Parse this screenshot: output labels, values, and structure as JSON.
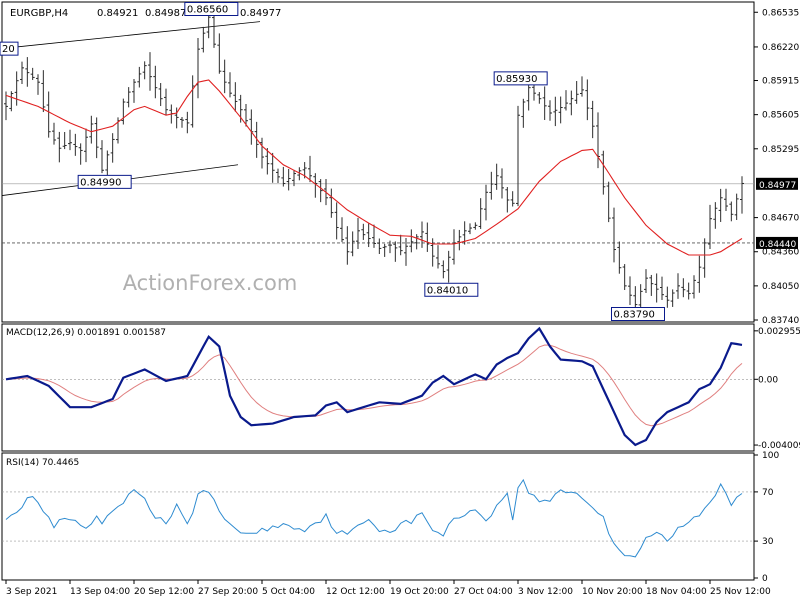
{
  "header": {
    "symbol_label": "EURGBP,H4",
    "ohlc_values": [
      "0.84921",
      "0.84987",
      "0.84906",
      "0.84977"
    ]
  },
  "watermark": "ActionForex.com",
  "colors": {
    "background": "#ffffff",
    "bar": "#2a2a2a",
    "ma": "#e02020",
    "macd_line": "#0a1a8c",
    "macd_signal": "#e08080",
    "rsi": "#2e8bd0",
    "level_line": "#555555",
    "frame": "#000000",
    "tag_border": "#0a1a8c",
    "current_price_tag": "#000000"
  },
  "price_panel": {
    "ylim": [
      0.8374,
      0.8661
    ],
    "y_ticks": [
      "0.86535",
      "0.86220",
      "0.85915",
      "0.85605",
      "0.85295",
      "0.84670",
      "0.84360",
      "0.84050",
      "0.83740"
    ],
    "current_price": "0.84977",
    "level_price": "0.84440",
    "annotations": [
      {
        "label": "0.86560",
        "x": 38.5,
        "y": 0.8656
      },
      {
        "label": "0.84990",
        "x": 18.5,
        "y": 0.8499
      },
      {
        "label": "0.85930",
        "x": 96.5,
        "y": 0.8593
      },
      {
        "label": "0.84010",
        "x": 83.5,
        "y": 0.8401
      },
      {
        "label": "0.83790",
        "x": 118.5,
        "y": 0.8379
      },
      {
        "label": "20",
        "x": -1,
        "y": 0.862
      }
    ]
  },
  "macd_panel": {
    "label": "MACD(12,26,9) 0.001891 0.001587",
    "ylim": [
      -0.00425,
      0.00325
    ],
    "y_ticks": [
      "0.002955",
      "0.00",
      "-0.004009"
    ]
  },
  "rsi_panel": {
    "label": "RSI(14) 70.4465",
    "ylim": [
      0,
      100
    ],
    "y_ticks": [
      "100",
      "70",
      "30",
      "0"
    ],
    "levels": [
      70,
      30
    ]
  },
  "x_axis": {
    "ticks": [
      {
        "label": "3 Sep 2021",
        "bar": 0
      },
      {
        "label": "13 Sep 04:00",
        "bar": 12
      },
      {
        "label": "20 Sep 12:00",
        "bar": 24
      },
      {
        "label": "27 Sep 20:00",
        "bar": 36
      },
      {
        "label": "5 Oct 04:00",
        "bar": 48
      },
      {
        "label": "12 Oct 12:00",
        "bar": 60
      },
      {
        "label": "19 Oct 20:00",
        "bar": 72
      },
      {
        "label": "27 Oct 04:00",
        "bar": 84
      },
      {
        "label": "3 Nov 12:00",
        "bar": 96
      },
      {
        "label": "10 Nov 20:00",
        "bar": 108
      },
      {
        "label": "18 Nov 04:00",
        "bar": 120
      },
      {
        "label": "25 Nov 12:00",
        "bar": 132
      }
    ]
  },
  "chart_data": {
    "type": "line",
    "series": [
      {
        "type": "ohlc",
        "close_anchors": [
          [
            0,
            0.8568
          ],
          [
            3,
            0.8603
          ],
          [
            6,
            0.859
          ],
          [
            8,
            0.8545
          ],
          [
            10,
            0.853
          ],
          [
            12,
            0.8535
          ],
          [
            14,
            0.8528
          ],
          [
            16,
            0.8552
          ],
          [
            18,
            0.851
          ],
          [
            20,
            0.8538
          ],
          [
            22,
            0.8572
          ],
          [
            24,
            0.859
          ],
          [
            26,
            0.8605
          ],
          [
            28,
            0.8585
          ],
          [
            30,
            0.8565
          ],
          [
            32,
            0.8558
          ],
          [
            34,
            0.8553
          ],
          [
            36,
            0.862
          ],
          [
            38,
            0.8649
          ],
          [
            40,
            0.86
          ],
          [
            42,
            0.858
          ],
          [
            44,
            0.8565
          ],
          [
            46,
            0.8545
          ],
          [
            48,
            0.8522
          ],
          [
            50,
            0.851
          ],
          [
            52,
            0.8498
          ],
          [
            54,
            0.8507
          ],
          [
            56,
            0.8512
          ],
          [
            58,
            0.8498
          ],
          [
            60,
            0.8485
          ],
          [
            62,
            0.8458
          ],
          [
            64,
            0.8436
          ],
          [
            66,
            0.8455
          ],
          [
            68,
            0.8448
          ],
          [
            70,
            0.8439
          ],
          [
            72,
            0.8442
          ],
          [
            74,
            0.8437
          ],
          [
            76,
            0.8445
          ],
          [
            78,
            0.8454
          ],
          [
            80,
            0.8432
          ],
          [
            82,
            0.8418
          ],
          [
            84,
            0.8444
          ],
          [
            86,
            0.8455
          ],
          [
            88,
            0.846
          ],
          [
            90,
            0.849
          ],
          [
            92,
            0.8505
          ],
          [
            94,
            0.8483
          ],
          [
            95,
            0.848
          ],
          [
            96,
            0.856
          ],
          [
            97,
            0.8572
          ],
          [
            98,
            0.8585
          ],
          [
            100,
            0.8575
          ],
          [
            102,
            0.8562
          ],
          [
            104,
            0.8567
          ],
          [
            106,
            0.8575
          ],
          [
            108,
            0.8583
          ],
          [
            110,
            0.855
          ],
          [
            112,
            0.8495
          ],
          [
            114,
            0.8438
          ],
          [
            116,
            0.8405
          ],
          [
            118,
            0.8388
          ],
          [
            120,
            0.8412
          ],
          [
            122,
            0.8402
          ],
          [
            124,
            0.8392
          ],
          [
            126,
            0.8405
          ],
          [
            128,
            0.8398
          ],
          [
            130,
            0.8422
          ],
          [
            132,
            0.8466
          ],
          [
            134,
            0.8485
          ],
          [
            136,
            0.847
          ],
          [
            138,
            0.8498
          ]
        ]
      },
      {
        "type": "line",
        "ma_anchors": [
          [
            0,
            0.8578
          ],
          [
            6,
            0.8568
          ],
          [
            12,
            0.8553
          ],
          [
            16,
            0.8545
          ],
          [
            20,
            0.855
          ],
          [
            24,
            0.8565
          ],
          [
            26,
            0.8568
          ],
          [
            30,
            0.856
          ],
          [
            32,
            0.8562
          ],
          [
            34,
            0.8577
          ],
          [
            36,
            0.859
          ],
          [
            38,
            0.8592
          ],
          [
            40,
            0.8582
          ],
          [
            44,
            0.8558
          ],
          [
            48,
            0.8532
          ],
          [
            52,
            0.8515
          ],
          [
            56,
            0.8505
          ],
          [
            60,
            0.849
          ],
          [
            64,
            0.8474
          ],
          [
            68,
            0.8462
          ],
          [
            72,
            0.8451
          ],
          [
            76,
            0.845
          ],
          [
            80,
            0.8443
          ],
          [
            84,
            0.8443
          ],
          [
            88,
            0.8448
          ],
          [
            92,
            0.8461
          ],
          [
            96,
            0.8475
          ],
          [
            100,
            0.85
          ],
          [
            104,
            0.8518
          ],
          [
            108,
            0.8528
          ],
          [
            110,
            0.8529
          ],
          [
            112,
            0.8515
          ],
          [
            116,
            0.8485
          ],
          [
            120,
            0.846
          ],
          [
            124,
            0.8443
          ],
          [
            128,
            0.8433
          ],
          [
            132,
            0.8433
          ],
          [
            134,
            0.8436
          ],
          [
            138,
            0.8448
          ]
        ]
      },
      {
        "type": "macd",
        "anchors": [
          [
            0,
            0.0
          ],
          [
            4,
            0.0002
          ],
          [
            8,
            -0.0004
          ],
          [
            12,
            -0.0017
          ],
          [
            16,
            -0.0017
          ],
          [
            20,
            -0.0012
          ],
          [
            22,
            0.0001
          ],
          [
            26,
            0.0006
          ],
          [
            30,
            -0.0001
          ],
          [
            34,
            0.0002
          ],
          [
            38,
            0.0026
          ],
          [
            40,
            0.002
          ],
          [
            42,
            -0.001
          ],
          [
            44,
            -0.0023
          ],
          [
            46,
            -0.0028
          ],
          [
            50,
            -0.0027
          ],
          [
            54,
            -0.0023
          ],
          [
            58,
            -0.0022
          ],
          [
            60,
            -0.0016
          ],
          [
            62,
            -0.0014
          ],
          [
            64,
            -0.002
          ],
          [
            68,
            -0.0016
          ],
          [
            70,
            -0.0014
          ],
          [
            74,
            -0.0015
          ],
          [
            78,
            -0.001
          ],
          [
            80,
            -0.0002
          ],
          [
            82,
            0.0002
          ],
          [
            84,
            -0.0003
          ],
          [
            88,
            0.0003
          ],
          [
            90,
            0.0
          ],
          [
            92,
            0.0009
          ],
          [
            94,
            0.0013
          ],
          [
            96,
            0.0016
          ],
          [
            98,
            0.0025
          ],
          [
            100,
            0.0031
          ],
          [
            102,
            0.002
          ],
          [
            104,
            0.0012
          ],
          [
            108,
            0.0011
          ],
          [
            110,
            0.0008
          ],
          [
            112,
            -0.0006
          ],
          [
            114,
            -0.002
          ],
          [
            116,
            -0.0034
          ],
          [
            118,
            -0.004
          ],
          [
            120,
            -0.0037
          ],
          [
            122,
            -0.0026
          ],
          [
            124,
            -0.002
          ],
          [
            128,
            -0.0014
          ],
          [
            130,
            -0.0006
          ],
          [
            132,
            -0.0003
          ],
          [
            134,
            0.0007
          ],
          [
            136,
            0.0022
          ],
          [
            138,
            0.0021
          ]
        ]
      },
      {
        "type": "rsi",
        "anchors": [
          [
            0,
            50
          ],
          [
            3,
            58
          ],
          [
            5,
            68
          ],
          [
            7,
            54
          ],
          [
            9,
            42
          ],
          [
            11,
            48
          ],
          [
            13,
            45
          ],
          [
            15,
            40
          ],
          [
            17,
            48
          ],
          [
            18,
            42
          ],
          [
            20,
            55
          ],
          [
            22,
            60
          ],
          [
            24,
            72
          ],
          [
            26,
            65
          ],
          [
            28,
            50
          ],
          [
            30,
            45
          ],
          [
            32,
            58
          ],
          [
            34,
            42
          ],
          [
            36,
            68
          ],
          [
            38,
            72
          ],
          [
            40,
            52
          ],
          [
            42,
            44
          ],
          [
            44,
            38
          ],
          [
            46,
            35
          ],
          [
            50,
            42
          ],
          [
            52,
            43
          ],
          [
            56,
            40
          ],
          [
            58,
            45
          ],
          [
            60,
            50
          ],
          [
            62,
            38
          ],
          [
            64,
            35
          ],
          [
            68,
            48
          ],
          [
            70,
            40
          ],
          [
            72,
            38
          ],
          [
            74,
            44
          ],
          [
            76,
            46
          ],
          [
            78,
            52
          ],
          [
            80,
            40
          ],
          [
            82,
            35
          ],
          [
            84,
            48
          ],
          [
            86,
            53
          ],
          [
            88,
            55
          ],
          [
            90,
            48
          ],
          [
            92,
            58
          ],
          [
            93,
            62
          ],
          [
            94,
            70
          ],
          [
            95,
            48
          ],
          [
            96,
            75
          ],
          [
            97,
            78
          ],
          [
            98,
            70
          ],
          [
            100,
            62
          ],
          [
            102,
            64
          ],
          [
            104,
            72
          ],
          [
            106,
            70
          ],
          [
            108,
            66
          ],
          [
            110,
            58
          ],
          [
            112,
            48
          ],
          [
            114,
            28
          ],
          [
            116,
            20
          ],
          [
            118,
            18
          ],
          [
            120,
            32
          ],
          [
            122,
            38
          ],
          [
            124,
            28
          ],
          [
            126,
            40
          ],
          [
            128,
            45
          ],
          [
            130,
            52
          ],
          [
            132,
            60
          ],
          [
            134,
            75
          ],
          [
            135,
            70
          ],
          [
            136,
            60
          ],
          [
            138,
            70
          ]
        ]
      }
    ]
  }
}
